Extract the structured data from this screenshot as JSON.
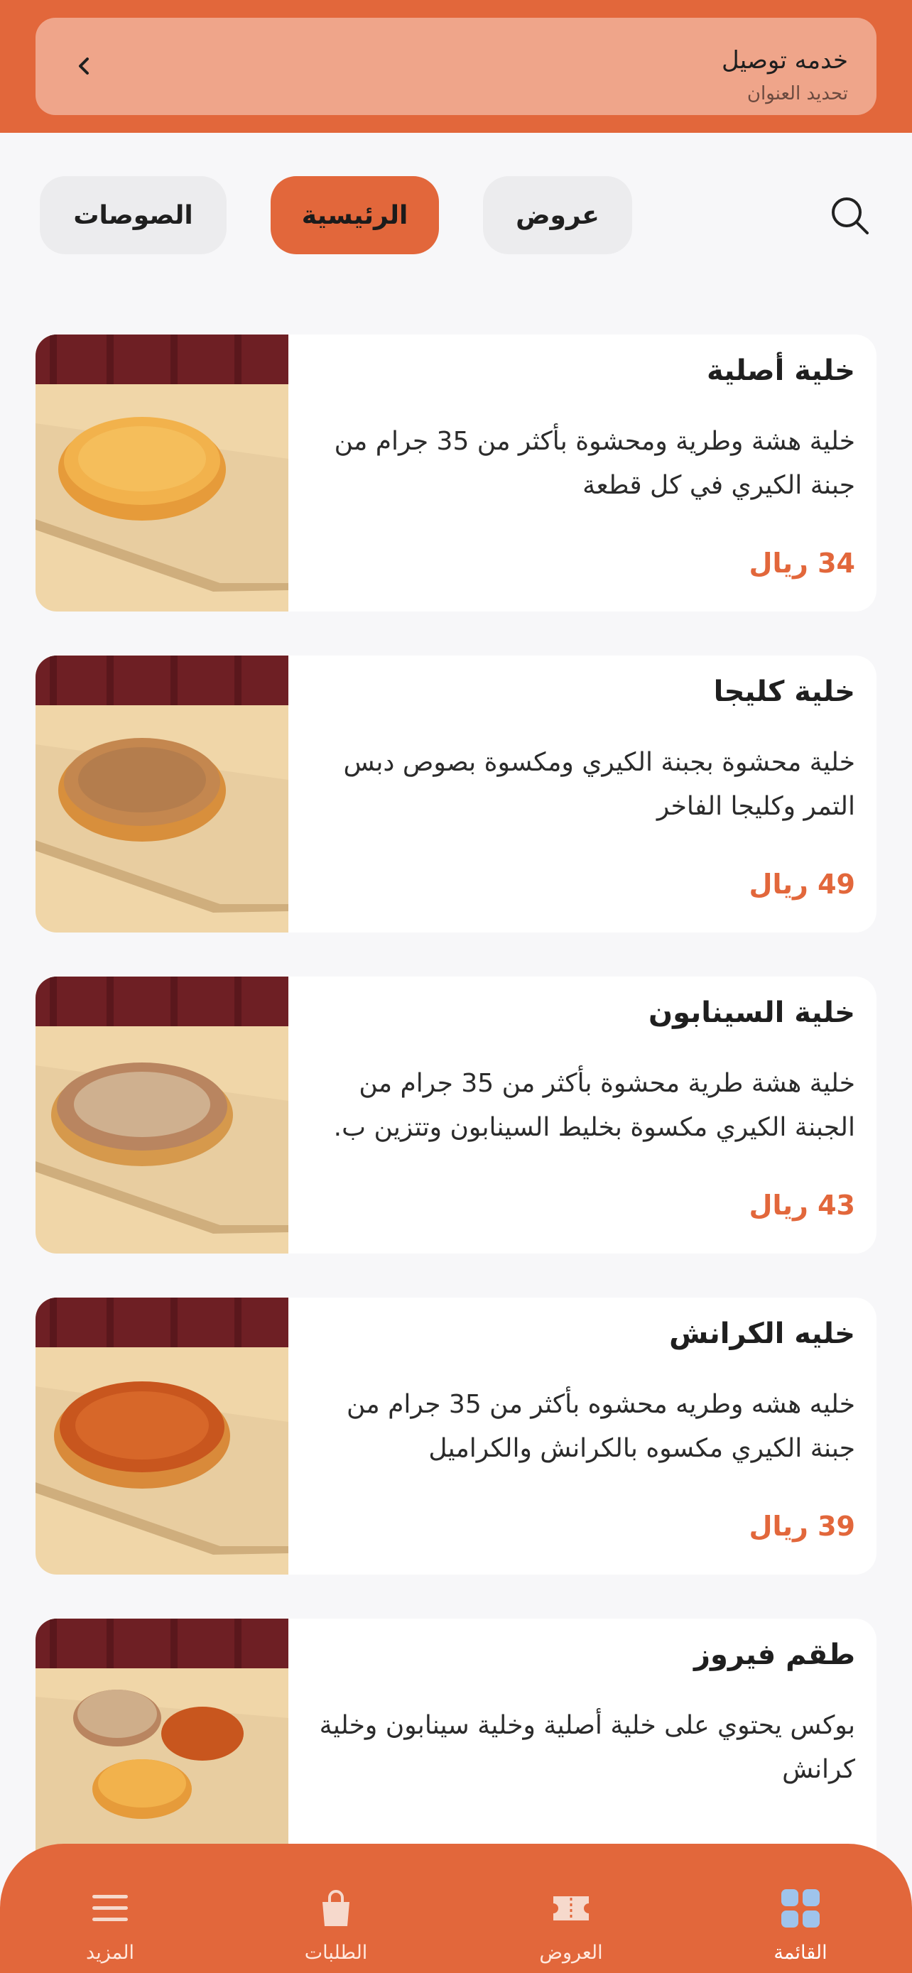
{
  "delivery": {
    "title": "خدمه توصيل",
    "subtitle": "تحديد العنوان",
    "chevron_icon": "chevron-left-icon"
  },
  "search": {
    "icon": "search-icon"
  },
  "categories": [
    {
      "label": "عروض",
      "active": false
    },
    {
      "label": "الرئيسية",
      "active": true
    },
    {
      "label": "الصوصات",
      "active": false
    }
  ],
  "products": [
    {
      "title": "خلية أصلية",
      "description": "خلية هشة وطرية ومحشوة بأكثر من 35 جرام من جبنة الكيري في كل قطعة",
      "price": "34 ريال"
    },
    {
      "title": "خلية كليجا",
      "description": "خلية محشوة بجبنة الكيري ومكسوة بصوص دبس التمر وكليجا الفاخر",
      "price": "49 ريال"
    },
    {
      "title": "خلية السينابون",
      "description": "خلية هشة طرية محشوة بأكثر من 35 جرام من الجبنة الكيري مكسوة بخليط السينابون وتتزين ب.",
      "price": "43 ريال"
    },
    {
      "title": "خليه الكرانش",
      "description": "خليه هشه وطريه محشوه بأكثر من 35 جرام من جبنة الكيري  مكسوه  بالكرانش والكراميل",
      "price": "39 ريال"
    },
    {
      "title": "طقم فيروز",
      "description": "بوكس يحتوي على خلية أصلية وخلية سينابون وخلية كرانش",
      "price": ""
    }
  ],
  "bottom_nav": [
    {
      "label": "القائمة",
      "icon": "grid-icon",
      "active": true
    },
    {
      "label": "العروض",
      "icon": "ticket-icon",
      "active": false
    },
    {
      "label": "الطلبات",
      "icon": "shopping-bag-icon",
      "active": false
    },
    {
      "label": "المزيد",
      "icon": "menu-icon",
      "active": false
    }
  ],
  "colors": {
    "accent": "#e2673b",
    "delivery_card": "#efa58a",
    "background": "#f7f7f9",
    "pill_inactive": "#ececee",
    "nav_active_icon": "#9fc4ec"
  }
}
